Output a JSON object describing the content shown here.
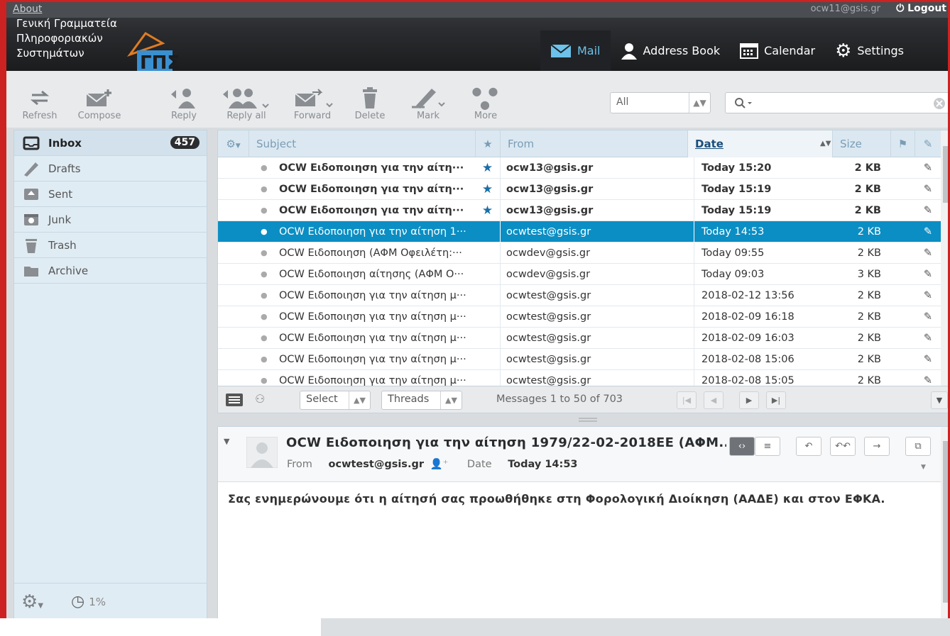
{
  "topbar": {
    "about": "About",
    "user_email": "ocw11@gsis.gr",
    "logout": "Logout",
    "logo_lines": [
      "Γενική Γραμματεία",
      "Πληροφοριακών",
      "Συστημάτων"
    ],
    "nav": [
      "Mail",
      "Address Book",
      "Calendar",
      "Settings"
    ]
  },
  "toolbar": {
    "refresh": "Refresh",
    "compose": "Compose",
    "reply": "Reply",
    "reply_all": "Reply all",
    "forward": "Forward",
    "delete": "Delete",
    "mark": "Mark",
    "more": "More",
    "filter_value": "All"
  },
  "folders": [
    {
      "label": "Inbox",
      "icon": "inbox-icon",
      "count": "457"
    },
    {
      "label": "Drafts",
      "icon": "pencil-icon"
    },
    {
      "label": "Sent",
      "icon": "sent-icon"
    },
    {
      "label": "Junk",
      "icon": "junk-icon"
    },
    {
      "label": "Trash",
      "icon": "trash-icon"
    },
    {
      "label": "Archive",
      "icon": "archive-icon"
    }
  ],
  "quota": "1%",
  "columns": {
    "subject": "Subject",
    "from": "From",
    "date": "Date",
    "size": "Size"
  },
  "messages": [
    {
      "subject": "OCW Ειδοποιηση για την αίτη···",
      "from": "ocw13@gsis.gr",
      "date": "Today 15:20",
      "size": "2 KB",
      "flagged": true,
      "unread": true
    },
    {
      "subject": "OCW Ειδοποιηση για την αίτη···",
      "from": "ocw13@gsis.gr",
      "date": "Today 15:19",
      "size": "2 KB",
      "flagged": true,
      "unread": true
    },
    {
      "subject": "OCW Ειδοποιηση για την αίτη···",
      "from": "ocw13@gsis.gr",
      "date": "Today 15:19",
      "size": "2 KB",
      "flagged": true,
      "unread": true
    },
    {
      "subject": "OCW Ειδοποιηση για την αίτηση 1···",
      "from": "ocwtest@gsis.gr",
      "date": "Today 14:53",
      "size": "2 KB",
      "selected": true
    },
    {
      "subject": "OCW Ειδοποιηση (ΑΦΜ Οφειλέτη:···",
      "from": "ocwdev@gsis.gr",
      "date": "Today 09:55",
      "size": "2 KB"
    },
    {
      "subject": "OCW Ειδοποιηση αίτησης (ΑΦΜ Ο···",
      "from": "ocwdev@gsis.gr",
      "date": "Today 09:03",
      "size": "3 KB"
    },
    {
      "subject": "OCW Ειδοποιηση για την αίτηση μ···",
      "from": "ocwtest@gsis.gr",
      "date": "2018-02-12 13:56",
      "size": "2 KB"
    },
    {
      "subject": "OCW Ειδοποιηση για την αίτηση μ···",
      "from": "ocwtest@gsis.gr",
      "date": "2018-02-09 16:18",
      "size": "2 KB"
    },
    {
      "subject": "OCW Ειδοποιηση για την αίτηση μ···",
      "from": "ocwtest@gsis.gr",
      "date": "2018-02-09 16:03",
      "size": "2 KB"
    },
    {
      "subject": "OCW Ειδοποιηση για την αίτηση μ···",
      "from": "ocwtest@gsis.gr",
      "date": "2018-02-08 15:06",
      "size": "2 KB"
    },
    {
      "subject": "OCW Ειδοποιηση για την αίτηση μ···",
      "from": "ocwtest@gsis.gr",
      "date": "2018-02-08 15:05",
      "size": "2 KB"
    }
  ],
  "list_footer": {
    "select": "Select",
    "threads": "Threads",
    "count_text": "Messages 1 to 50 of 703"
  },
  "preview": {
    "subject": "OCW Ειδοποιηση για την αίτηση 1979/22-02-2018ΕΕ (ΑΦΜ...",
    "from_label": "From",
    "from": "ocwtest@gsis.gr",
    "date_label": "Date",
    "date": "Today 14:53",
    "body": "Σας ενημερώνουμε ότι η αίτησή σας προωθήθηκε στη Φορολογική Διοίκηση (ΑΑΔΕ) και στον ΕΦΚΑ."
  },
  "colors": {
    "accent": "#0b8ec3",
    "frame": "#cc2222",
    "star": "#1a6fa8"
  }
}
